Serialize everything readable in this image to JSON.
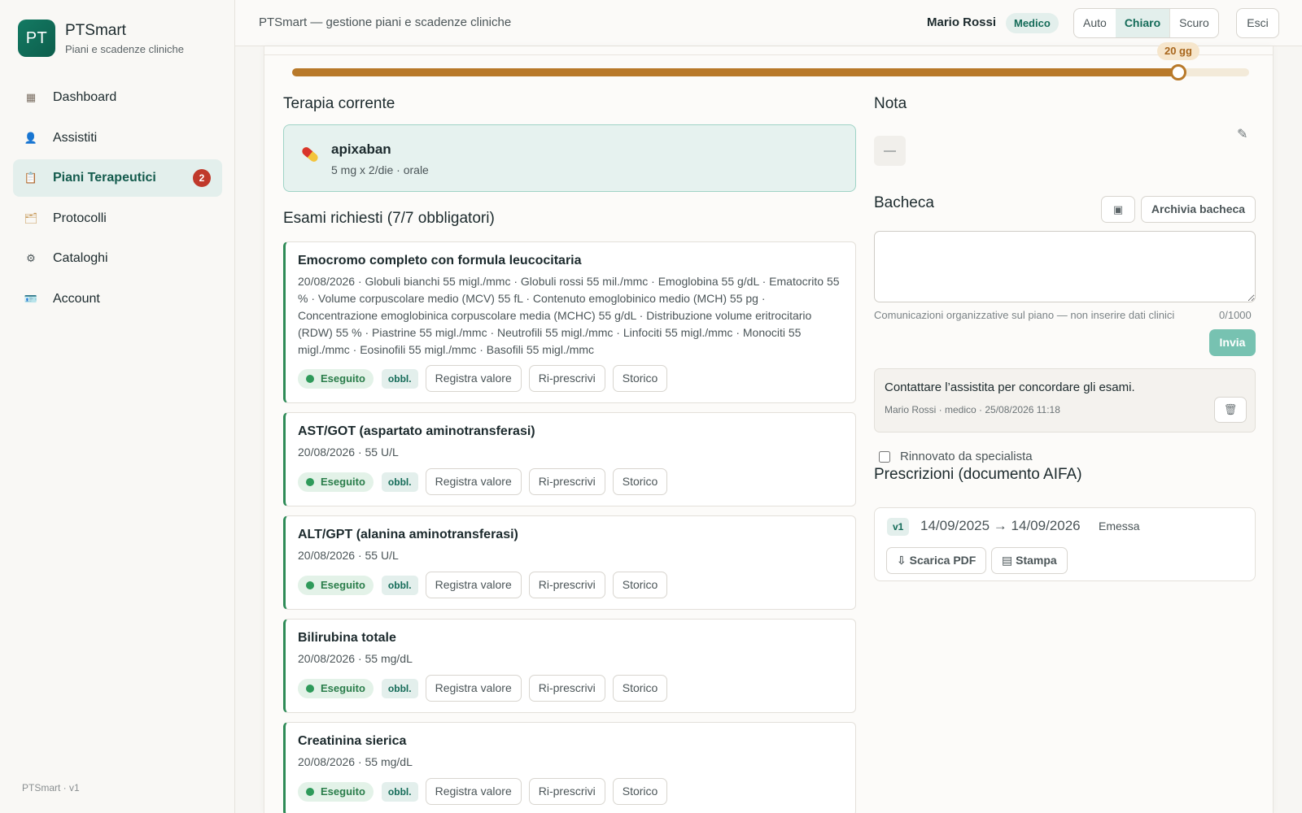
{
  "brand": {
    "logo_text": "PT",
    "name": "PTSmart",
    "subtitle": "Piani e scadenze cliniche"
  },
  "sidebar": {
    "items": [
      {
        "label": "Dashboard",
        "icon": "dashboard-icon",
        "active": false
      },
      {
        "label": "Assistiti",
        "icon": "user-icon",
        "active": false
      },
      {
        "label": "Piani Terapeutici",
        "icon": "clipboard-icon",
        "active": true,
        "badge": "2"
      },
      {
        "label": "Protocolli",
        "icon": "folder-icon",
        "active": false
      },
      {
        "label": "Cataloghi",
        "icon": "gear-icon",
        "active": false
      },
      {
        "label": "Account",
        "icon": "id-card-icon",
        "active": false
      }
    ],
    "version": "PTSmart · v1"
  },
  "topbar": {
    "title": "PTSmart — gestione piani e scadenze cliniche",
    "user_name": "Mario Rossi",
    "role": "Medico",
    "theme_options": [
      "Auto",
      "Chiaro",
      "Scuro"
    ],
    "theme_selected": "Chiaro",
    "logout_label": "Esci"
  },
  "progress": {
    "label": "20 gg",
    "fraction": 0.926,
    "color": "#b8792a"
  },
  "therapy": {
    "section_title": "Terapia corrente",
    "drug": "apixaban",
    "dose": "5 mg x 2/die · orale"
  },
  "exams": {
    "section_title": "Esami richiesti (7/7 obbligatori)",
    "status_label": "Eseguito",
    "mandatory_label": "obbl.",
    "action_register": "Registra valore",
    "action_represcribe": "Ri-prescrivi",
    "action_history": "Storico",
    "items": [
      {
        "name": "Emocromo completo con formula leucocitaria",
        "detail": "20/08/2026 · Globuli bianchi 55 migl./mmc · Globuli rossi 55 mil./mmc · Emoglobina 55 g/dL · Ematocrito 55 % · Volume corpuscolare medio (MCV) 55 fL · Contenuto emoglobinico medio (MCH) 55 pg · Concentrazione emoglobinica corpuscolare media (MCHC) 55 g/dL · Distribuzione volume eritrocitario (RDW) 55 % · Piastrine 55 migl./mmc · Neutrofili 55 migl./mmc · Linfociti 55 migl./mmc · Monociti 55 migl./mmc · Eosinofili 55 migl./mmc · Basofili 55 migl./mmc"
      },
      {
        "name": "AST/GOT (aspartato aminotransferasi)",
        "detail": "20/08/2026 · 55 U/L"
      },
      {
        "name": "ALT/GPT (alanina aminotransferasi)",
        "detail": "20/08/2026 · 55 U/L"
      },
      {
        "name": "Bilirubina totale",
        "detail": "20/08/2026 · 55 mg/dL"
      },
      {
        "name": "Creatinina sierica",
        "detail": "20/08/2026 · 55 mg/dL"
      }
    ]
  },
  "note": {
    "section_title": "Nota",
    "value": "—"
  },
  "board": {
    "section_title": "Bacheca",
    "archive_label": "Archivia bacheca",
    "textarea_value": "",
    "hint": "Comunicazioni organizzative sul piano — non inserire dati clinici",
    "counter": "0/1000",
    "send_label": "Invia",
    "message": {
      "text": "Contattare l’assistita per concordare gli esami.",
      "meta": "Mario Rossi · medico · 25/08/2026 11:18"
    }
  },
  "renewed": {
    "label": "Rinnovato da specialista",
    "checked": false
  },
  "prescriptions": {
    "section_title": "Prescrizioni (documento AIFA)",
    "version": "v1",
    "dates": "14/09/2025 → 14/09/2026",
    "status": "Emessa",
    "download_label": "⇩ Scarica PDF",
    "print_label": "Stampa"
  }
}
